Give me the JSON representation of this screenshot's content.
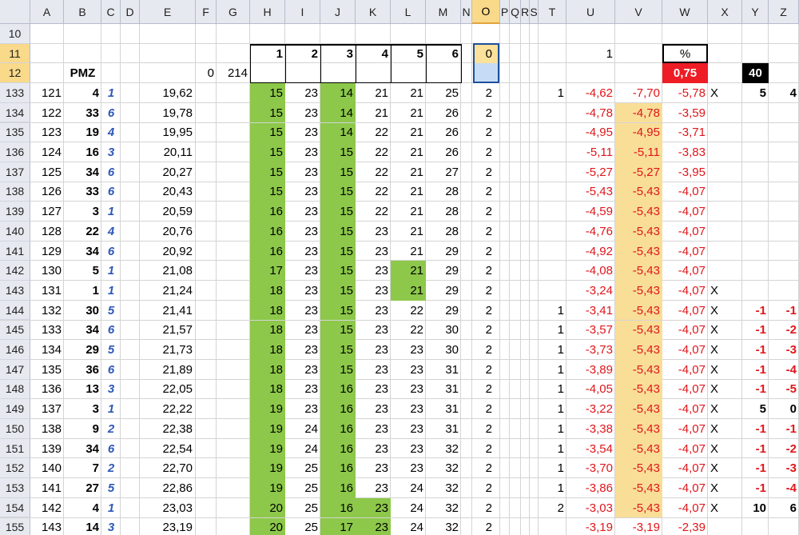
{
  "columns": [
    "A",
    "B",
    "C",
    "D",
    "E",
    "F",
    "G",
    "H",
    "I",
    "J",
    "K",
    "L",
    "M",
    "N",
    "O",
    "P",
    "Q",
    "R",
    "S",
    "T",
    "U",
    "V",
    "W",
    "X",
    "Y",
    "Z"
  ],
  "selected_column": "O",
  "header_rows": [
    {
      "row": "10",
      "cells": {}
    },
    {
      "row": "11",
      "cells": {
        "H": "1",
        "I": "2",
        "J": "3",
        "K": "4",
        "L": "5",
        "M": "6",
        "O": "0",
        "U": "1",
        "W": "%"
      }
    },
    {
      "row": "12",
      "cells": {
        "B": "PMZ",
        "F": "0",
        "G": "214",
        "W": "0,75",
        "Y": "40"
      }
    }
  ],
  "rows": [
    {
      "row": "133",
      "A": "121",
      "B": "4",
      "C": "1",
      "E": "19,62",
      "H": "15",
      "I": "23",
      "J": "14",
      "K": "21",
      "L": "21",
      "M": "25",
      "O": "2",
      "T": "1",
      "U": "-4,62",
      "V": "-7,70",
      "W": "-5,78",
      "X": "X",
      "Y": "5",
      "Z": "4"
    },
    {
      "row": "134",
      "A": "122",
      "B": "33",
      "C": "6",
      "E": "19,78",
      "H": "15",
      "I": "23",
      "J": "14",
      "K": "21",
      "L": "21",
      "M": "26",
      "O": "2",
      "U": "-4,78",
      "V": "-4,78",
      "W": "-3,59"
    },
    {
      "row": "135",
      "A": "123",
      "B": "19",
      "C": "4",
      "E": "19,95",
      "H": "15",
      "I": "23",
      "J": "14",
      "K": "22",
      "L": "21",
      "M": "26",
      "O": "2",
      "U": "-4,95",
      "V": "-4,95",
      "W": "-3,71"
    },
    {
      "row": "136",
      "A": "124",
      "B": "16",
      "C": "3",
      "E": "20,11",
      "H": "15",
      "I": "23",
      "J": "15",
      "K": "22",
      "L": "21",
      "M": "26",
      "O": "2",
      "U": "-5,11",
      "V": "-5,11",
      "W": "-3,83"
    },
    {
      "row": "137",
      "A": "125",
      "B": "34",
      "C": "6",
      "E": "20,27",
      "H": "15",
      "I": "23",
      "J": "15",
      "K": "22",
      "L": "21",
      "M": "27",
      "O": "2",
      "U": "-5,27",
      "V": "-5,27",
      "W": "-3,95"
    },
    {
      "row": "138",
      "A": "126",
      "B": "33",
      "C": "6",
      "E": "20,43",
      "H": "15",
      "I": "23",
      "J": "15",
      "K": "22",
      "L": "21",
      "M": "28",
      "O": "2",
      "U": "-5,43",
      "V": "-5,43",
      "W": "-4,07"
    },
    {
      "row": "139",
      "A": "127",
      "B": "3",
      "C": "1",
      "E": "20,59",
      "H": "16",
      "I": "23",
      "J": "15",
      "K": "22",
      "L": "21",
      "M": "28",
      "O": "2",
      "U": "-4,59",
      "V": "-5,43",
      "W": "-4,07"
    },
    {
      "row": "140",
      "A": "128",
      "B": "22",
      "C": "4",
      "E": "20,76",
      "H": "16",
      "I": "23",
      "J": "15",
      "K": "23",
      "L": "21",
      "M": "28",
      "O": "2",
      "U": "-4,76",
      "V": "-5,43",
      "W": "-4,07"
    },
    {
      "row": "141",
      "A": "129",
      "B": "34",
      "C": "6",
      "E": "20,92",
      "H": "16",
      "I": "23",
      "J": "15",
      "K": "23",
      "L": "21",
      "M": "29",
      "O": "2",
      "U": "-4,92",
      "V": "-5,43",
      "W": "-4,07"
    },
    {
      "row": "142",
      "A": "130",
      "B": "5",
      "C": "1",
      "E": "21,08",
      "H": "17",
      "I": "23",
      "J": "15",
      "K": "23",
      "L": "21",
      "M": "29",
      "O": "2",
      "U": "-4,08",
      "V": "-5,43",
      "W": "-4,07"
    },
    {
      "row": "143",
      "A": "131",
      "B": "1",
      "C": "1",
      "E": "21,24",
      "H": "18",
      "I": "23",
      "J": "15",
      "K": "23",
      "L": "21",
      "M": "29",
      "O": "2",
      "U": "-3,24",
      "V": "-5,43",
      "W": "-4,07",
      "X": "X"
    },
    {
      "row": "144",
      "A": "132",
      "B": "30",
      "C": "5",
      "E": "21,41",
      "H": "18",
      "I": "23",
      "J": "15",
      "K": "23",
      "L": "22",
      "M": "29",
      "O": "2",
      "T": "1",
      "U": "-3,41",
      "V": "-5,43",
      "W": "-4,07",
      "X": "X",
      "Y": "-1",
      "Z": "-1"
    },
    {
      "row": "145",
      "A": "133",
      "B": "34",
      "C": "6",
      "E": "21,57",
      "H": "18",
      "I": "23",
      "J": "15",
      "K": "23",
      "L": "22",
      "M": "30",
      "O": "2",
      "T": "1",
      "U": "-3,57",
      "V": "-5,43",
      "W": "-4,07",
      "X": "X",
      "Y": "-1",
      "Z": "-2"
    },
    {
      "row": "146",
      "A": "134",
      "B": "29",
      "C": "5",
      "E": "21,73",
      "H": "18",
      "I": "23",
      "J": "15",
      "K": "23",
      "L": "23",
      "M": "30",
      "O": "2",
      "T": "1",
      "U": "-3,73",
      "V": "-5,43",
      "W": "-4,07",
      "X": "X",
      "Y": "-1",
      "Z": "-3"
    },
    {
      "row": "147",
      "A": "135",
      "B": "36",
      "C": "6",
      "E": "21,89",
      "H": "18",
      "I": "23",
      "J": "15",
      "K": "23",
      "L": "23",
      "M": "31",
      "O": "2",
      "T": "1",
      "U": "-3,89",
      "V": "-5,43",
      "W": "-4,07",
      "X": "X",
      "Y": "-1",
      "Z": "-4"
    },
    {
      "row": "148",
      "A": "136",
      "B": "13",
      "C": "3",
      "E": "22,05",
      "H": "18",
      "I": "23",
      "J": "16",
      "K": "23",
      "L": "23",
      "M": "31",
      "O": "2",
      "T": "1",
      "U": "-4,05",
      "V": "-5,43",
      "W": "-4,07",
      "X": "X",
      "Y": "-1",
      "Z": "-5"
    },
    {
      "row": "149",
      "A": "137",
      "B": "3",
      "C": "1",
      "E": "22,22",
      "H": "19",
      "I": "23",
      "J": "16",
      "K": "23",
      "L": "23",
      "M": "31",
      "O": "2",
      "T": "1",
      "U": "-3,22",
      "V": "-5,43",
      "W": "-4,07",
      "X": "X",
      "Y": "5",
      "Z": "0"
    },
    {
      "row": "150",
      "A": "138",
      "B": "9",
      "C": "2",
      "E": "22,38",
      "H": "19",
      "I": "24",
      "J": "16",
      "K": "23",
      "L": "23",
      "M": "31",
      "O": "2",
      "T": "1",
      "U": "-3,38",
      "V": "-5,43",
      "W": "-4,07",
      "X": "X",
      "Y": "-1",
      "Z": "-1"
    },
    {
      "row": "151",
      "A": "139",
      "B": "34",
      "C": "6",
      "E": "22,54",
      "H": "19",
      "I": "24",
      "J": "16",
      "K": "23",
      "L": "23",
      "M": "32",
      "O": "2",
      "T": "1",
      "U": "-3,54",
      "V": "-5,43",
      "W": "-4,07",
      "X": "X",
      "Y": "-1",
      "Z": "-2"
    },
    {
      "row": "152",
      "A": "140",
      "B": "7",
      "C": "2",
      "E": "22,70",
      "H": "19",
      "I": "25",
      "J": "16",
      "K": "23",
      "L": "23",
      "M": "32",
      "O": "2",
      "T": "1",
      "U": "-3,70",
      "V": "-5,43",
      "W": "-4,07",
      "X": "X",
      "Y": "-1",
      "Z": "-3"
    },
    {
      "row": "153",
      "A": "141",
      "B": "27",
      "C": "5",
      "E": "22,86",
      "H": "19",
      "I": "25",
      "J": "16",
      "K": "23",
      "L": "24",
      "M": "32",
      "O": "2",
      "T": "1",
      "U": "-3,86",
      "V": "-5,43",
      "W": "-4,07",
      "X": "X",
      "Y": "-1",
      "Z": "-4"
    },
    {
      "row": "154",
      "A": "142",
      "B": "4",
      "C": "1",
      "E": "23,03",
      "H": "20",
      "I": "25",
      "J": "16",
      "K": "23",
      "L": "24",
      "M": "32",
      "O": "2",
      "T": "2",
      "U": "-3,03",
      "V": "-5,43",
      "W": "-4,07",
      "X": "X",
      "Y": "10",
      "Z": "6"
    },
    {
      "row": "155",
      "A": "143",
      "B": "14",
      "C": "3",
      "E": "23,19",
      "H": "20",
      "I": "25",
      "J": "17",
      "K": "23",
      "L": "24",
      "M": "32",
      "O": "2",
      "U": "-3,19",
      "V": "-3,19",
      "W": "-2,39"
    }
  ],
  "green_cells": {
    "L": [
      "142",
      "143"
    ],
    "K": [
      "154",
      "155"
    ]
  },
  "tan_cells_V": [
    "134",
    "135",
    "136",
    "137",
    "138",
    "139",
    "140",
    "141",
    "142",
    "143",
    "144",
    "145",
    "146",
    "147",
    "148",
    "149",
    "150",
    "151",
    "152",
    "153",
    "154"
  ],
  "colors": {
    "green": "#8dc84a",
    "tan": "#f9de97",
    "red": "#e0161b",
    "blue": "#2e58b8",
    "selected": "#f9d98a"
  }
}
